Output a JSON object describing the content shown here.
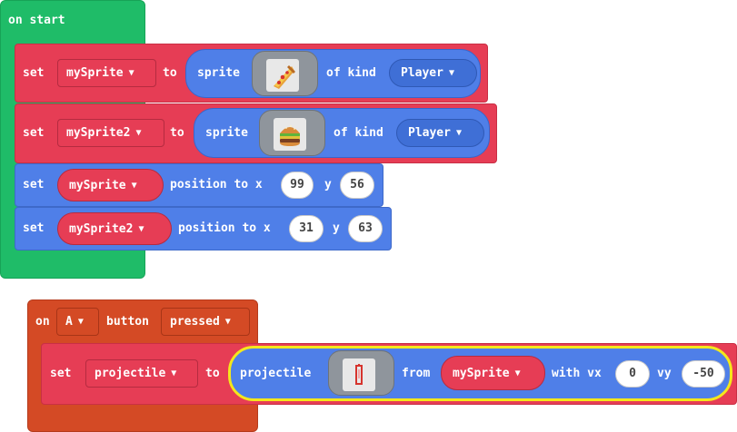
{
  "on_start": {
    "label": "on start",
    "rows": [
      {
        "set": "set",
        "var": "mySprite",
        "to": "to",
        "sprite": "sprite",
        "of_kind": "of kind",
        "kind": "Player",
        "image": "pizza-icon"
      },
      {
        "set": "set",
        "var": "mySprite2",
        "to": "to",
        "sprite": "sprite",
        "of_kind": "of kind",
        "kind": "Player",
        "image": "burger-icon"
      },
      {
        "set": "set",
        "var": "mySprite",
        "position_to_x": "position to x",
        "x": "99",
        "y_label": "y",
        "y": "56"
      },
      {
        "set": "set",
        "var": "mySprite2",
        "position_to_x": "position to x",
        "x": "31",
        "y_label": "y",
        "y": "63"
      }
    ]
  },
  "on_button": {
    "on": "on",
    "button": "A",
    "button_label": "button",
    "event": "pressed",
    "row": {
      "set": "set",
      "var": "projectile",
      "to": "to",
      "projectile": "projectile",
      "image": "projectile-icon",
      "from": "from",
      "sprite": "mySprite",
      "with_vx": "with vx",
      "vx": "0",
      "vy_label": "vy",
      "vy": "-50"
    }
  },
  "colors": {
    "events": "#1fbc68",
    "variables": "#e63d55",
    "sprites": "#4f7fe8",
    "controller": "#d44a25",
    "highlight": "#f4e71c"
  }
}
